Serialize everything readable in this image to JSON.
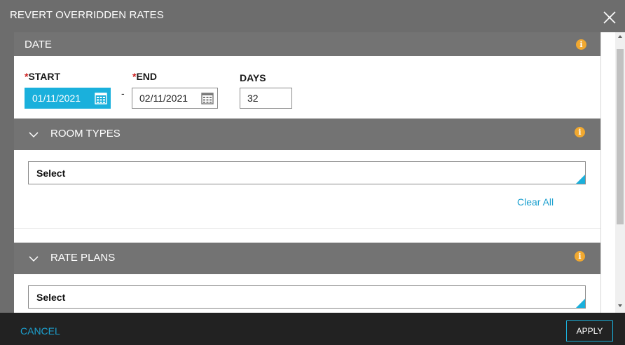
{
  "dialog": {
    "title": "REVERT OVERRIDDEN RATES",
    "close_icon": "close-icon"
  },
  "date_section": {
    "header": "DATE",
    "start": {
      "required_mark": "*",
      "label": "START",
      "value": "01/11/2021"
    },
    "separator": "-",
    "end": {
      "required_mark": "*",
      "label": "END",
      "value": "02/11/2021"
    },
    "days": {
      "label": "DAYS",
      "value": "32"
    }
  },
  "room_types": {
    "header": "ROOM TYPES",
    "select_value": "Select",
    "clear_all": "Clear All"
  },
  "rate_plans": {
    "header": "RATE PLANS",
    "select_value": "Select"
  },
  "footer": {
    "cancel": "CANCEL",
    "apply": "APPLY"
  },
  "colors": {
    "header_gray": "#737373",
    "accent_blue": "#1ab0dc",
    "link_blue": "#1ca0cf",
    "info_orange": "#f0a830",
    "required_red": "#cc1f1f"
  }
}
